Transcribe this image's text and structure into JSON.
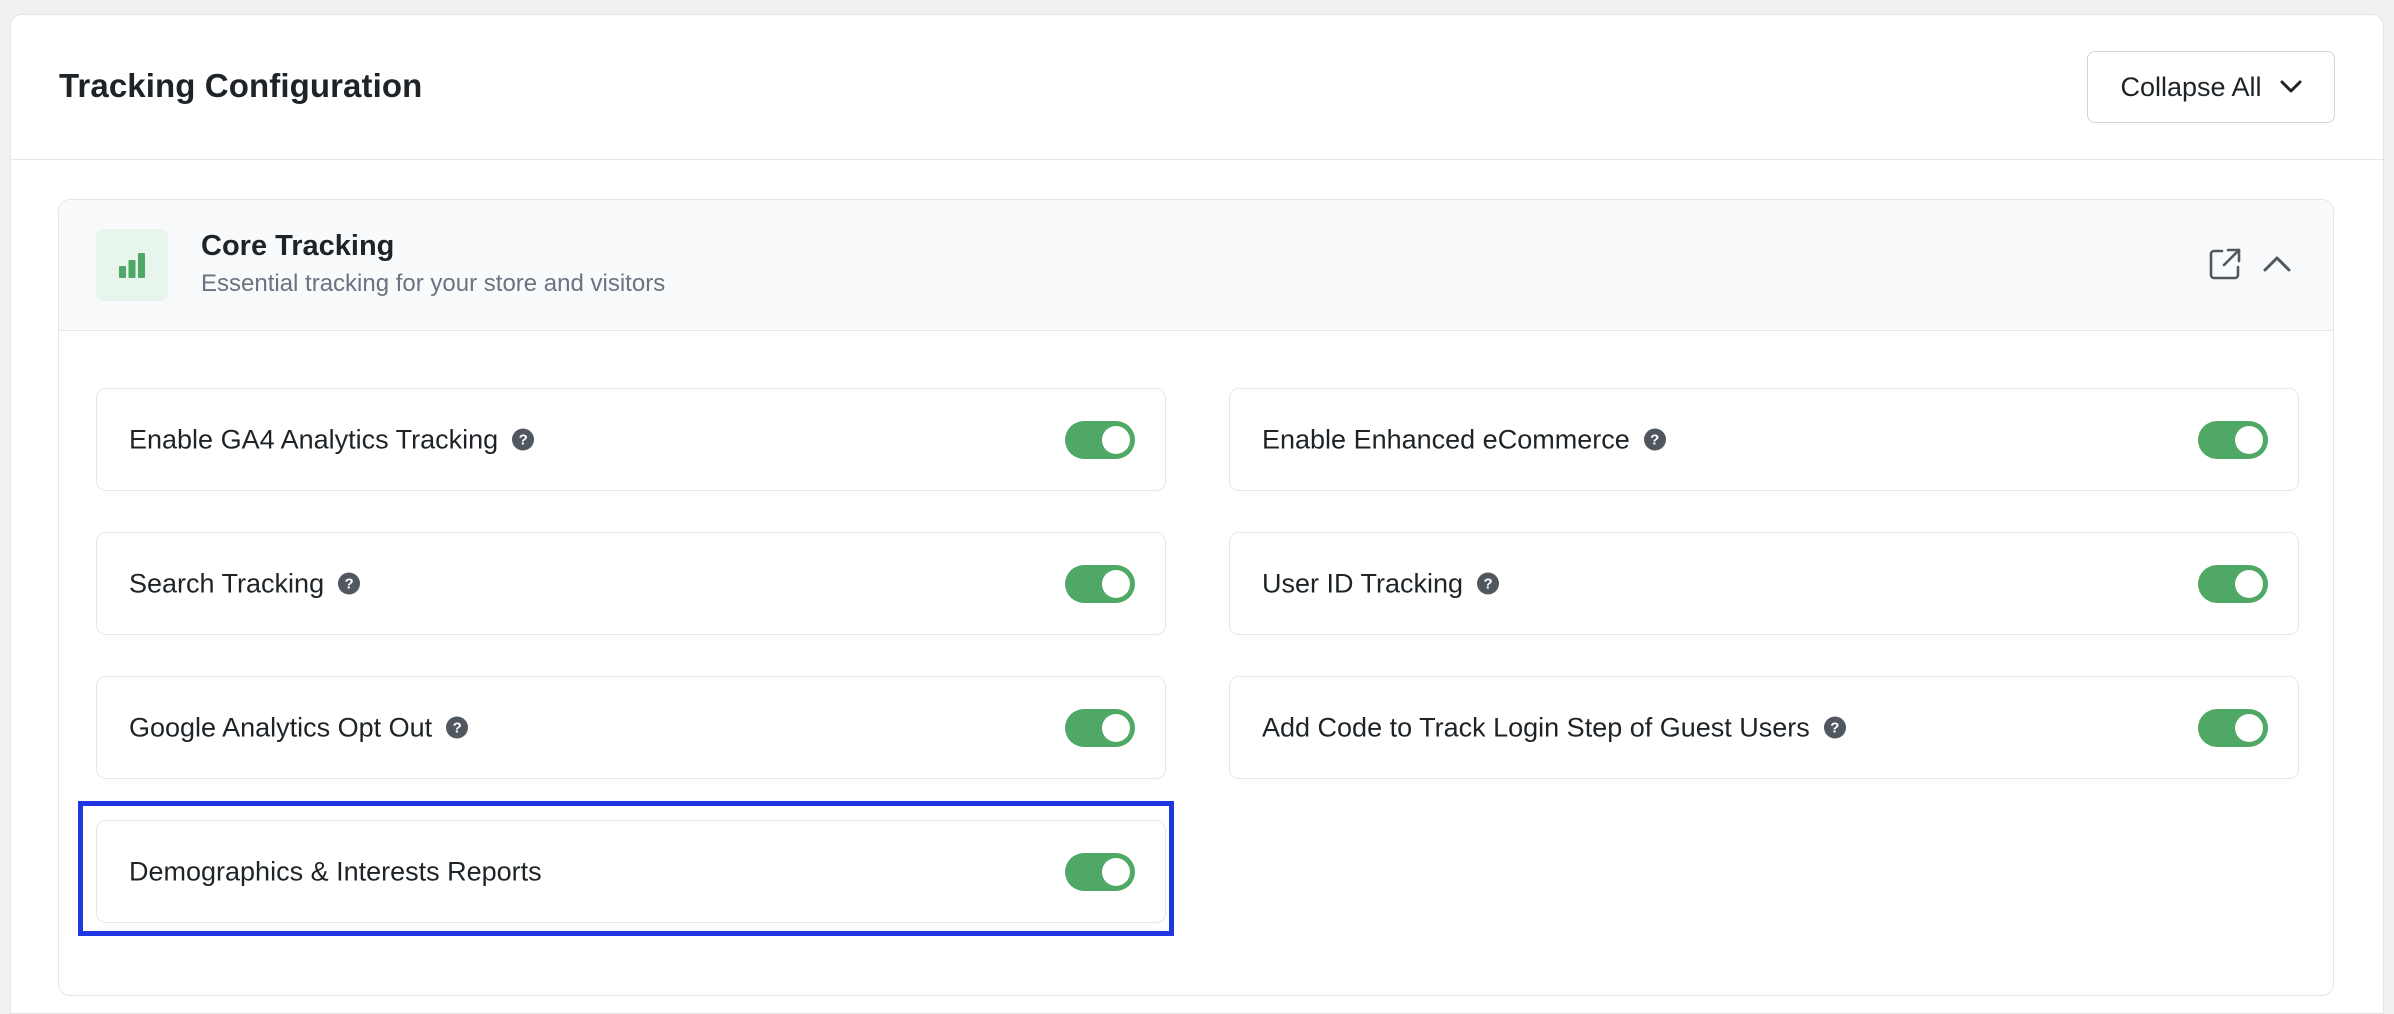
{
  "header": {
    "title": "Tracking Configuration",
    "collapse_label": "Collapse All"
  },
  "section": {
    "icon": "bar-chart-icon",
    "title": "Core Tracking",
    "subtitle": "Essential tracking for your store and visitors"
  },
  "settings": [
    {
      "label": "Enable GA4 Analytics Tracking",
      "help": true,
      "enabled": true
    },
    {
      "label": "Enable Enhanced eCommerce",
      "help": true,
      "enabled": true
    },
    {
      "label": "Search Tracking",
      "help": true,
      "enabled": true
    },
    {
      "label": "User ID Tracking",
      "help": true,
      "enabled": true
    },
    {
      "label": "Google Analytics Opt Out",
      "help": true,
      "enabled": true
    },
    {
      "label": "Add Code to Track Login Step of Guest Users",
      "help": true,
      "enabled": true
    },
    {
      "label": "Demographics & Interests Reports",
      "help": false,
      "enabled": true
    }
  ],
  "help_glyph": "?",
  "colors": {
    "accent_green": "#4fa865",
    "highlight_blue": "#1f36e0"
  }
}
